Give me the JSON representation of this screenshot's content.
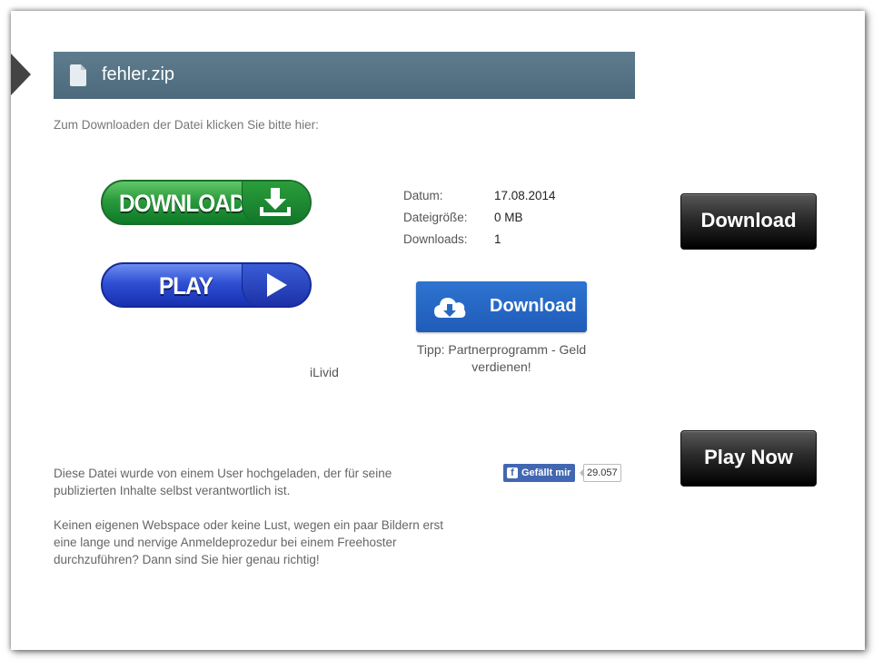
{
  "file": {
    "name": "fehler.zip"
  },
  "intro_text": "Zum Downloaden der Datei klicken Sie bitte hier:",
  "ad_buttons": {
    "download_label": "DOWNLOAD",
    "play_label": "PLAY",
    "ilivid": "iLivid"
  },
  "meta": [
    {
      "key": "Datum:",
      "value": "17.08.2014"
    },
    {
      "key": "Dateigröße:",
      "value": "0 MB"
    },
    {
      "key": "Downloads:",
      "value": "1"
    }
  ],
  "download_button": {
    "label": "Download",
    "tip": "Tipp: Partnerprogramm - Geld verdienen!"
  },
  "side_buttons": {
    "download": "Download",
    "play_now": "Play Now"
  },
  "notice": {
    "p1": "Diese Datei wurde von einem User hochgeladen, der für seine publizierten Inhalte selbst verantwortlich ist.",
    "p2": "Keinen eigenen Webspace oder keine Lust, wegen ein paar Bildern erst eine lange und nervige Anmeldeprozedur bei einem Freehoster durchzuführen? Dann sind Sie hier genau richtig!"
  },
  "facebook": {
    "like_label": "Gefällt mir",
    "count": "29.057"
  },
  "colors": {
    "title_bar": "#557385",
    "green": "#1f8a33",
    "blue": "#2a47cc",
    "download_blue": "#2668c4"
  },
  "icons": {
    "file": "file-icon",
    "download_arrow": "download-arrow-icon",
    "play": "play-icon",
    "cloud": "cloud-download-icon",
    "facebook": "facebook-icon"
  }
}
